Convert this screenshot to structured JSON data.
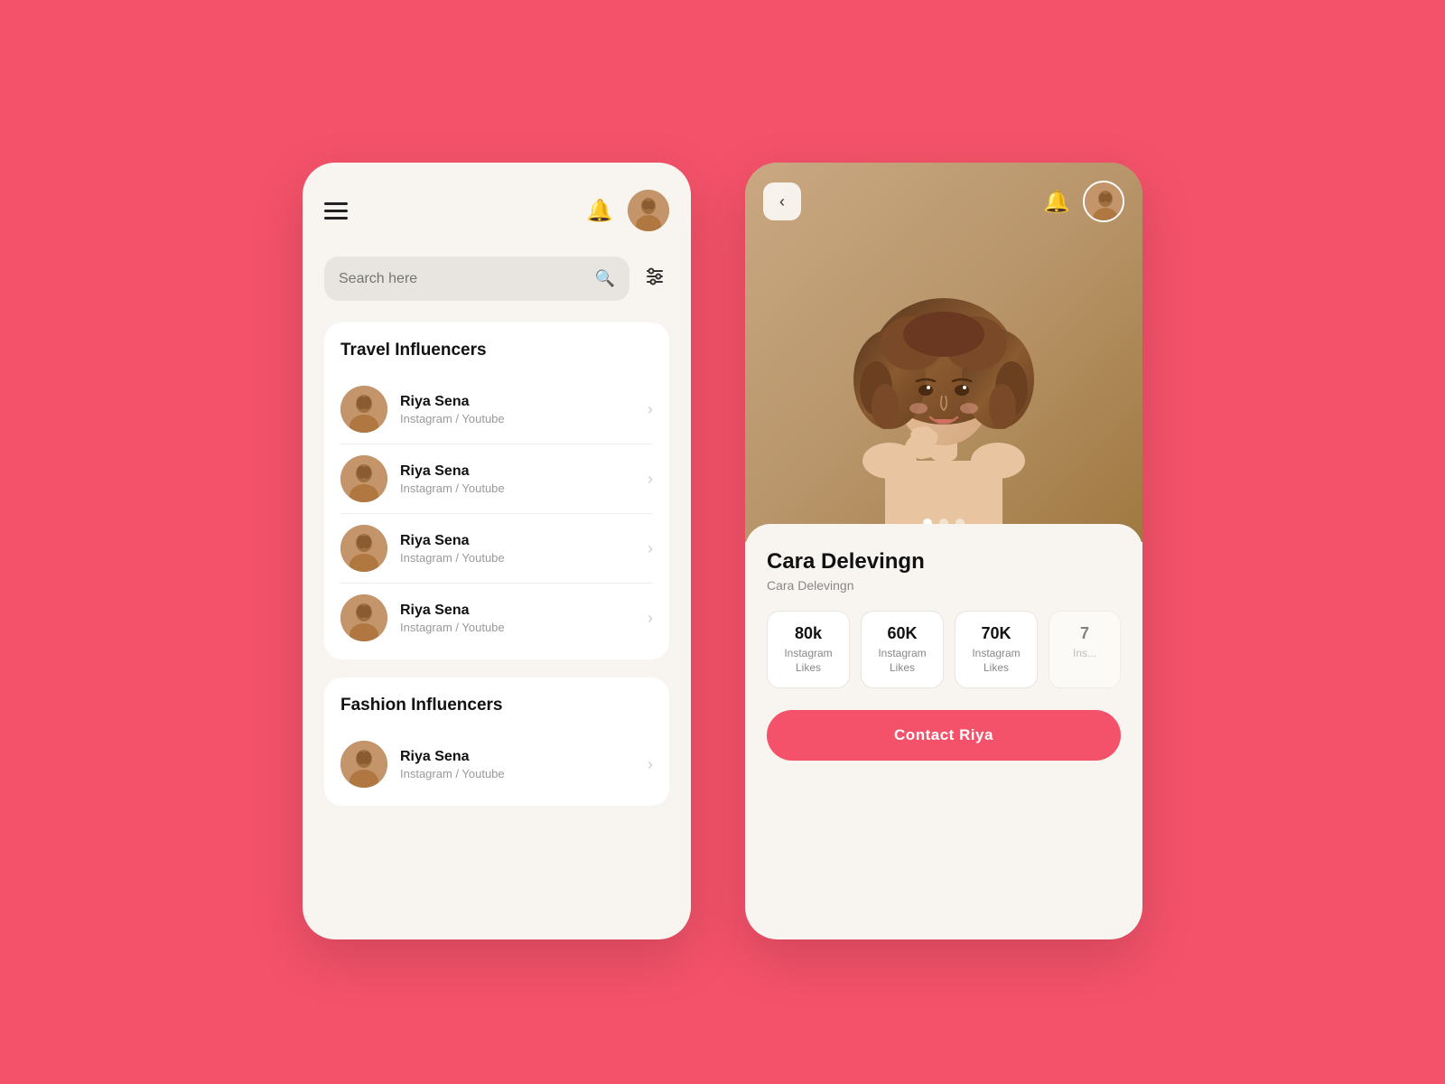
{
  "app": {
    "background_color": "#F4526A"
  },
  "left_panel": {
    "header": {
      "bell_label": "🔔",
      "avatar_label": "user-avatar"
    },
    "search": {
      "placeholder": "Search here",
      "icon": "🔍",
      "filter_icon": "⊞"
    },
    "sections": [
      {
        "id": "travel",
        "title": "Travel Influencers",
        "items": [
          {
            "name": "Riya Sena",
            "platform": "Instagram / Youtube"
          },
          {
            "name": "Riya Sena",
            "platform": "Instagram / Youtube"
          },
          {
            "name": "Riya Sena",
            "platform": "Instagram / Youtube"
          },
          {
            "name": "Riya Sena",
            "platform": "Instagram / Youtube"
          }
        ]
      },
      {
        "id": "fashion",
        "title": "Fashion Influencers",
        "items": [
          {
            "name": "Riya Sena",
            "platform": "Instagram / Youtube"
          }
        ]
      }
    ]
  },
  "right_panel": {
    "header": {
      "back_label": "‹",
      "bell_label": "🔔"
    },
    "dots": [
      {
        "active": true
      },
      {
        "active": false
      },
      {
        "active": false
      }
    ],
    "profile": {
      "name": "Cara Delevingn",
      "username": "Cara Delevingn",
      "stats": [
        {
          "value": "80k",
          "label": "Instagram\nLikes"
        },
        {
          "value": "60K",
          "label": "Instagram\nLikes"
        },
        {
          "value": "70K",
          "label": "Instagram\nLikes"
        },
        {
          "value": "7",
          "label": "Ins..."
        }
      ],
      "contact_button": "Contact Riya"
    }
  }
}
